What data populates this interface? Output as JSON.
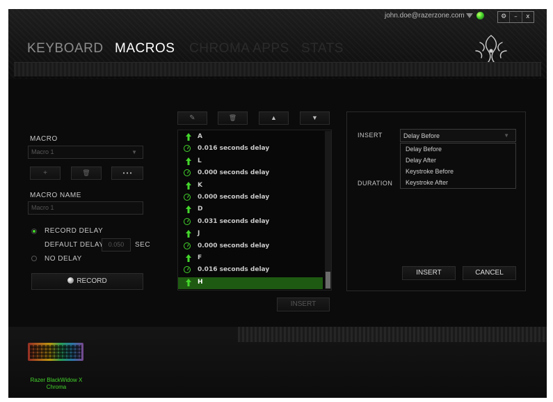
{
  "account": {
    "email": "john.doe@razerzone.com",
    "window_buttons": [
      "⚙",
      "–",
      "x"
    ]
  },
  "tabs": [
    {
      "label": "KEYBOARD"
    },
    {
      "label": "MACROS"
    },
    {
      "label": "CHROMA APPS"
    },
    {
      "label": "STATS"
    }
  ],
  "macro": {
    "section_label": "MACRO",
    "selected": "Macro 1",
    "add_label": "+",
    "delete_label": "🗑",
    "more_label": "• • •",
    "name_label": "MACRO NAME",
    "name_value": "Macro 1",
    "record_delay_label": "RECORD DELAY",
    "default_delay_label": "DEFAULT DELAY",
    "default_delay_value": "0.050",
    "sec_label": "SEC",
    "no_delay_label": "NO DELAY",
    "record_label": "RECORD"
  },
  "toolbar": {
    "edit": "✎",
    "delete": "🗑",
    "up": "▲",
    "down": "▼"
  },
  "events": [
    {
      "type": "key",
      "text": "A"
    },
    {
      "type": "delay",
      "text": "0.016 seconds delay"
    },
    {
      "type": "key",
      "text": "L"
    },
    {
      "type": "delay",
      "text": "0.000 seconds delay"
    },
    {
      "type": "key",
      "text": "K"
    },
    {
      "type": "delay",
      "text": "0.000 seconds delay"
    },
    {
      "type": "key",
      "text": "D"
    },
    {
      "type": "delay",
      "text": "0.031 seconds delay"
    },
    {
      "type": "key",
      "text": "J"
    },
    {
      "type": "delay",
      "text": "0.000 seconds delay"
    },
    {
      "type": "key",
      "text": "F"
    },
    {
      "type": "delay",
      "text": "0.016 seconds delay"
    },
    {
      "type": "key",
      "text": "H",
      "selected": true
    }
  ],
  "insert_button": "INSERT",
  "insert_panel": {
    "insert_label": "INSERT",
    "selected": "Delay Before",
    "options": [
      "Delay Before",
      "Delay After",
      "Keystroke Before",
      "Keystroke After"
    ],
    "duration_label": "DURATION",
    "insert_button": "INSERT",
    "cancel_button": "CANCEL"
  },
  "device": {
    "name_line1": "Razer BlackWidow X",
    "name_line2": "Chroma"
  },
  "colors": {
    "accent": "#44d62c",
    "selection": "#1f5a12",
    "background": "#0b0b0b"
  }
}
